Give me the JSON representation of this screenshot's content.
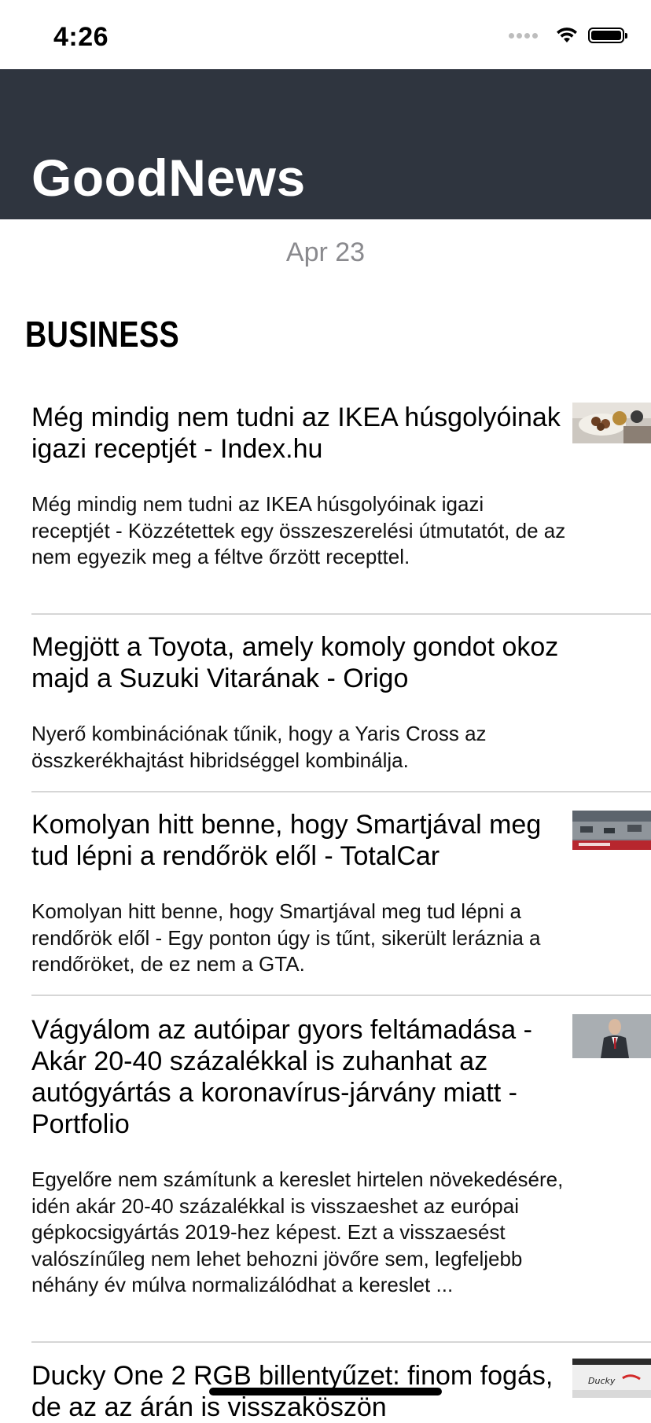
{
  "status_bar": {
    "time": "4:26"
  },
  "header": {
    "title": "GoodNews"
  },
  "date": "Apr 23",
  "section": {
    "title": "BUSINESS"
  },
  "articles": [
    {
      "headline": "Még mindig nem tudni az IKEA húsgolyóinak igazi receptjét - Index.hu",
      "summary": "Még mindig nem tudni az IKEA húsgolyóinak igazi receptjét - Közzétettek egy összeszerelési útmutatót, de az nem egyezik meg a féltve őrzött recepttel."
    },
    {
      "headline": "Megjött a Toyota, amely komoly gondot okoz majd a Suzuki Vitarának - Origo",
      "summary": "Nyerő kombinációnak tűnik, hogy a Yaris Cross az összkerékhajtást hibridséggel kombinálja."
    },
    {
      "headline": "Komolyan hitt benne, hogy Smartjával meg tud lépni a rendőrök elől - TotalCar",
      "summary": "Komolyan hitt benne, hogy Smartjával meg tud lépni a rendőrök elől - Egy ponton úgy is tűnt, sikerült leráznia a rendőröket, de ez nem a GTA."
    },
    {
      "headline": "Vágyálom az autóipar gyors feltámadása - Akár 20-40 százalékkal is zuhanhat az autógyártás a koronavírus-járvány miatt - Portfolio",
      "summary": "Egyelőre nem számítunk a kereslet hirtelen növekedésére, idén akár 20-40 százalékkal is visszaeshet az európai gépkocsigyártás 2019-hez képest. Ezt a visszaesést valószínűleg nem lehet behozni jövőre sem, legfeljebb néhány év múlva normalizálódhat a kereslet ..."
    },
    {
      "headline": "Ducky One 2 RGB billentyűzet: finom fogás, de az az árán is visszaköszön",
      "summary": ""
    }
  ]
}
